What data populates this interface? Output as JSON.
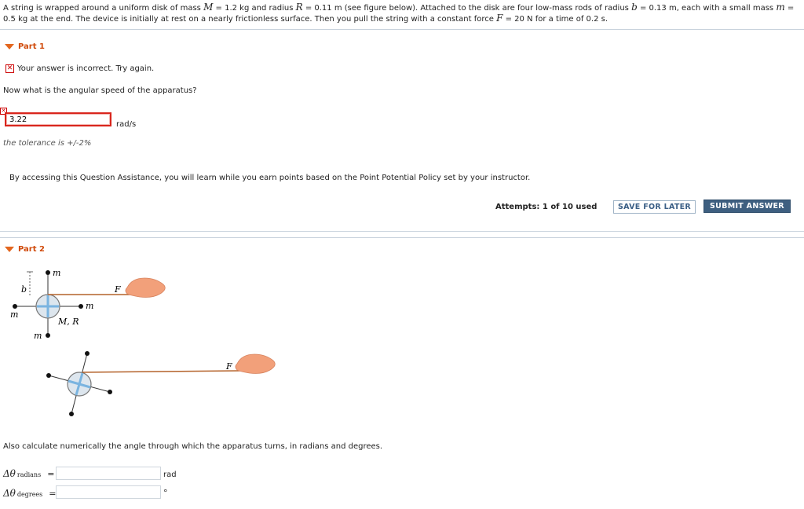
{
  "problem": {
    "seg1": "A string is wrapped around a uniform disk of mass ",
    "M_sym": "M",
    "seg2": " = 1.2 kg and radius ",
    "R_sym": "R",
    "seg3": " = 0.11 m (see figure below). Attached to the disk are four low-mass rods of radius ",
    "b_sym": "b",
    "seg4": " = 0.13 m, each with a small mass ",
    "m_sym": "m",
    "seg5": " = 0.5 kg at the end. The device is initially at rest on a nearly frictionless surface. Then you pull the string with a constant force ",
    "F_sym": "F",
    "seg6": " = 20 N for a time of 0.2 s."
  },
  "part1": {
    "title": "Part 1",
    "feedback": "Your answer is incorrect.  Try again.",
    "question": "Now what is the angular speed of the apparatus?",
    "answer_value": "3.22",
    "unit": "rad/s",
    "tolerance": "the tolerance is +/-2%",
    "assist_note": "By accessing this Question Assistance, you will learn while you earn points based on the Point Potential Policy set by your instructor.",
    "attempts": "Attempts: 1 of 10 used",
    "save_label": "SAVE FOR LATER",
    "submit_label": "SUBMIT ANSWER"
  },
  "part2": {
    "title": "Part 2",
    "figure": {
      "label_m": "m",
      "label_b": "b",
      "label_F": "F",
      "label_MR": "M, R"
    },
    "question": "Also calculate numerically the angle through which the apparatus turns, in radians and degrees.",
    "rad_label": "Δθ",
    "rad_sub": "radians",
    "deg_label": "Δθ",
    "deg_sub": "degrees",
    "equals": "=",
    "rad_value": "",
    "deg_value": "",
    "rad_unit": "rad",
    "deg_unit": "°"
  },
  "colors": {
    "accent_orange": "#e3661e",
    "error_red": "#d9251c",
    "button_blue": "#3e5f80",
    "string_brown": "#b4622a"
  }
}
